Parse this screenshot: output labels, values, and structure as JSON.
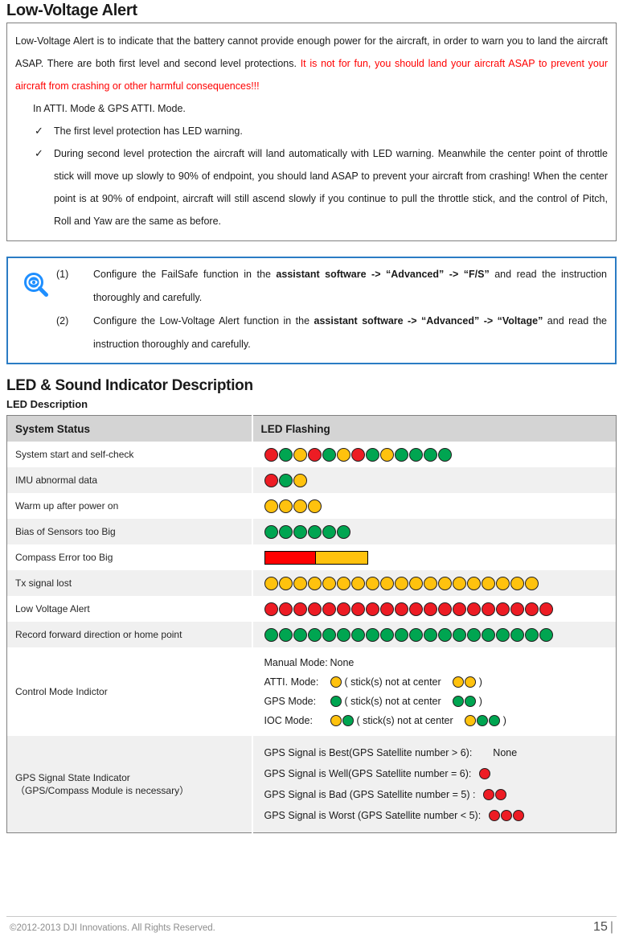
{
  "section": {
    "title": "Low-Voltage Alert",
    "body_part1": "Low-Voltage Alert is to indicate that the battery cannot provide enough power for the aircraft, in order to warn you to land the aircraft ASAP. There are both first level and second level protections. ",
    "body_red": "It is not for fun, you should land your aircraft ASAP to prevent your aircraft from crashing or other harmful consequences!!!",
    "mode_line": "In ATTI. Mode & GPS ATTI. Mode.",
    "bullets": [
      "The first level protection has LED warning.",
      "During second level protection the aircraft will land automatically with LED warning. Meanwhile the center point of throttle stick will move up slowly to 90% of endpoint, you should land ASAP to prevent your aircraft from crashing! When the center point is at 90% of endpoint, aircraft will still ascend slowly if you continue to pull the throttle stick, and the control of Pitch, Roll and Yaw are the same as before."
    ],
    "check_glyph": "✓"
  },
  "note": {
    "icon": "magnifier-eye-icon",
    "border_color": "#2b7cc4",
    "items": [
      {
        "num": "(1)",
        "pre": "Configure the FailSafe function in the ",
        "bold": "assistant software -> “Advanced” -> “F/S”",
        "post": " and read the instruction thoroughly and carefully."
      },
      {
        "num": "(2)",
        "pre": "Configure the Low-Voltage Alert function in the ",
        "bold": "assistant software -> “Advanced” -> “Voltage”",
        "post": " and read the instruction thoroughly and carefully."
      }
    ]
  },
  "led_section": {
    "title": "LED & Sound Indicator Description",
    "subtitle": "LED Description",
    "table": {
      "headers": [
        "System Status",
        "LED Flashing"
      ],
      "rows": [
        {
          "label": "System start and self-check",
          "type": "leds",
          "leds": [
            "red",
            "green",
            "yellow",
            "red",
            "green",
            "yellow",
            "red",
            "green",
            "yellow",
            "green",
            "green",
            "green",
            "green"
          ]
        },
        {
          "label": "IMU  abnormal  data",
          "type": "leds",
          "leds": [
            "red",
            "green",
            "yellow"
          ]
        },
        {
          "label": "Warm  up  after  power  on",
          "type": "leds",
          "leds": [
            "yellow",
            "yellow",
            "yellow",
            "yellow"
          ]
        },
        {
          "label": "Bias of Sensors too Big",
          "type": "leds",
          "leds": [
            "green",
            "green",
            "green",
            "green",
            "green",
            "green"
          ]
        },
        {
          "label": "Compass  Error  too  Big",
          "type": "bar",
          "bar": [
            "red",
            "yellow"
          ]
        },
        {
          "label": "Tx  signal  lost",
          "type": "leds",
          "leds": [
            "yellow",
            "yellow",
            "yellow",
            "yellow",
            "yellow",
            "yellow",
            "yellow",
            "yellow",
            "yellow",
            "yellow",
            "yellow",
            "yellow",
            "yellow",
            "yellow",
            "yellow",
            "yellow",
            "yellow",
            "yellow",
            "yellow"
          ]
        },
        {
          "label": "Low  Voltage  Alert",
          "type": "leds",
          "leds": [
            "red",
            "red",
            "red",
            "red",
            "red",
            "red",
            "red",
            "red",
            "red",
            "red",
            "red",
            "red",
            "red",
            "red",
            "red",
            "red",
            "red",
            "red",
            "red",
            "red"
          ]
        },
        {
          "label": "Record  forward  direction  or  home  point",
          "type": "leds",
          "leds": [
            "green",
            "green",
            "green",
            "green",
            "green",
            "green",
            "green",
            "green",
            "green",
            "green",
            "green",
            "green",
            "green",
            "green",
            "green",
            "green",
            "green",
            "green",
            "green",
            "green"
          ]
        }
      ],
      "control_mode": {
        "label": "Control Mode Indictor",
        "lines": [
          {
            "name": "Manual Mode:",
            "value_text": "None",
            "dots": [],
            "paren_dots": []
          },
          {
            "name": "ATTI. Mode:",
            "dots": [
              "yellow"
            ],
            "paren_open": "( stick(s) not at center",
            "paren_dots": [
              "yellow",
              "yellow"
            ],
            "paren_close": ")"
          },
          {
            "name": "GPS Mode:",
            "dots": [
              "green"
            ],
            "paren_open": "( stick(s) not at center",
            "paren_dots": [
              "green",
              "green"
            ],
            "paren_close": ")"
          },
          {
            "name": "IOC Mode:",
            "dots": [
              "yellow",
              "green"
            ],
            "paren_open": "( stick(s) not at center",
            "paren_dots": [
              "yellow",
              "green",
              "green"
            ],
            "paren_close": ")"
          }
        ]
      },
      "gps_indicator": {
        "label_line1": "GPS Signal State Indicator",
        "label_line2": "（GPS/Compass Module is necessary）",
        "lines": [
          {
            "text": "GPS Signal is Best(GPS Satellite number > 6):",
            "none_text": "None",
            "dots": []
          },
          {
            "text": "GPS Signal is Well(GPS Satellite number = 6):",
            "dots": [
              "red"
            ]
          },
          {
            "text": "GPS Signal is Bad (GPS Satellite number = 5) :",
            "dots": [
              "red",
              "red"
            ]
          },
          {
            "text": "GPS Signal is Worst (GPS Satellite number < 5):",
            "dots": [
              "red",
              "red",
              "red"
            ]
          }
        ]
      }
    }
  },
  "colors": {
    "red": "#ED1C24",
    "green": "#00A551",
    "yellow": "#FFC20E",
    "alert_red_text": "#FF0000",
    "note_blue": "#2b7cc4",
    "header_gray": "#d4d4d4",
    "row_alt": "#f0f0f0"
  },
  "footer": {
    "copyright": "©2012-2013  DJI  Innovations.  All  Rights  Reserved.",
    "page_number": "15",
    "page_bar": "|"
  }
}
